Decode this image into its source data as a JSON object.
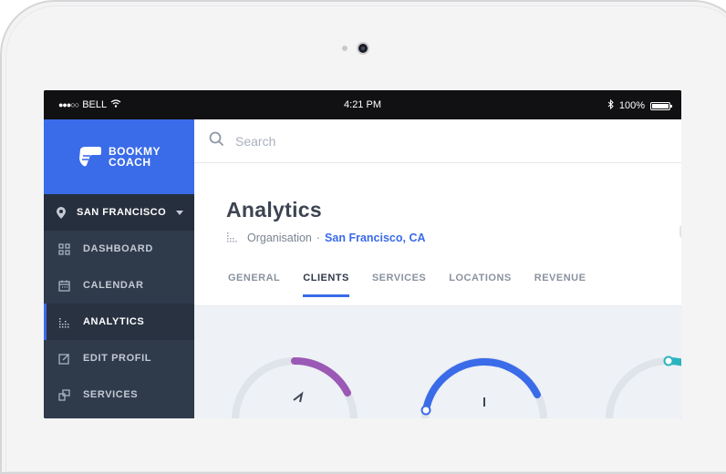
{
  "status_bar": {
    "carrier": "BELL",
    "time": "4:21 PM",
    "battery": "100%"
  },
  "brand": {
    "line1": "BOOKMY",
    "line2": "COACH"
  },
  "location": {
    "name": "SAN FRANCISCO"
  },
  "sidebar": {
    "items": [
      {
        "label": "DASHBOARD",
        "icon": "grid-icon"
      },
      {
        "label": "CALENDAR",
        "icon": "calendar-icon"
      },
      {
        "label": "ANALYTICS",
        "icon": "analytics-icon",
        "active": true
      },
      {
        "label": "EDIT PROFIL",
        "icon": "edit-icon"
      },
      {
        "label": "SERVICES",
        "icon": "services-icon"
      }
    ]
  },
  "search": {
    "placeholder": "Search"
  },
  "page": {
    "title": "Analytics",
    "breadcrumb_root": "Organisation",
    "breadcrumb_sep": "·",
    "breadcrumb_current": "San Francisco, CA"
  },
  "tabs": [
    {
      "label": "GENERAL"
    },
    {
      "label": "CLIENTS",
      "active": true
    },
    {
      "label": "SERVICES"
    },
    {
      "label": "LOCATIONS"
    },
    {
      "label": "REVENUE"
    }
  ],
  "colors": {
    "accent": "#3a6be8",
    "sidebar": "#2f3a4b",
    "ring_purple": "#9b59b6",
    "ring_blue": "#3a6be8",
    "ring_teal": "#2bb3c0",
    "ring_track": "#dfe3ea"
  }
}
